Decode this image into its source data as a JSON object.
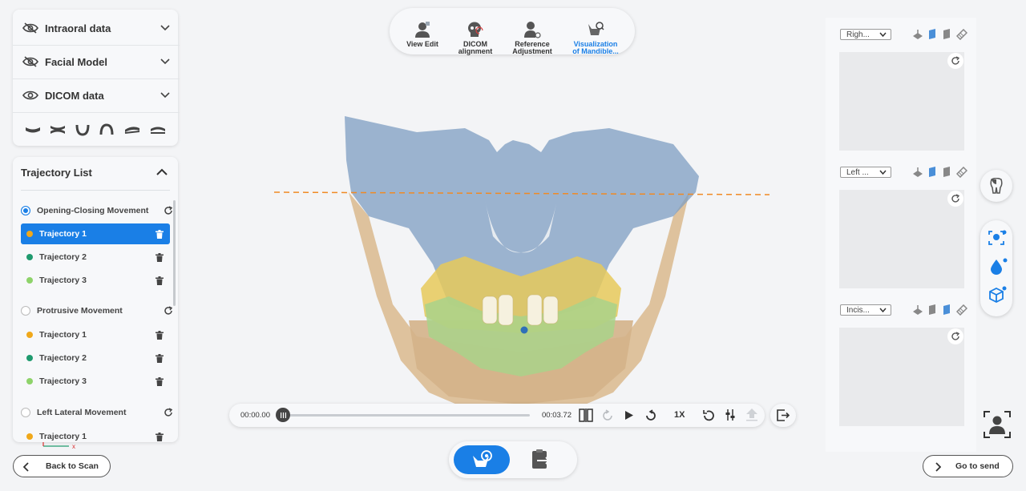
{
  "layers": [
    {
      "label": "Intraoral data",
      "visible": false
    },
    {
      "label": "Facial Model",
      "visible": false
    },
    {
      "label": "DICOM data",
      "visible": true
    }
  ],
  "view_presets": [
    "arch-lower-icon",
    "arch-both-icon",
    "arch-u-icon",
    "arch-n-icon",
    "arch-tilt-icon",
    "arch-flat-icon"
  ],
  "trajectory_list": {
    "title": "Trajectory List",
    "groups": [
      {
        "label": "Opening-Closing Movement",
        "selected": true,
        "items": [
          {
            "label": "Trajectory 1",
            "color": "#f0a81a"
          },
          {
            "label": "Trajectory 2",
            "color": "#1f9a6e"
          },
          {
            "label": "Trajectory 3",
            "color": "#8ed36a"
          }
        ]
      },
      {
        "label": "Protrusive Movement",
        "selected": false,
        "items": [
          {
            "label": "Trajectory 1",
            "color": "#f0a81a"
          },
          {
            "label": "Trajectory 2",
            "color": "#1f9a6e"
          },
          {
            "label": "Trajectory 3",
            "color": "#8ed36a"
          }
        ]
      },
      {
        "label": "Left Lateral Movement",
        "selected": false,
        "items": [
          {
            "label": "Trajectory 1",
            "color": "#f0a81a"
          }
        ]
      }
    ],
    "selected_item": "Trajectory 1"
  },
  "toolbar": {
    "tools": [
      {
        "label1": "View Edit",
        "label2": "",
        "icon": "user-edit-icon"
      },
      {
        "label1": "DICOM",
        "label2": "alignment",
        "icon": "skull-icon"
      },
      {
        "label1": "Reference",
        "label2": "Adjustment",
        "icon": "person-adjust-icon"
      },
      {
        "label1": "Visualization",
        "label2": "of Mandible...",
        "icon": "mandible-search-icon",
        "active": true
      }
    ]
  },
  "playback": {
    "current_time": "00:00.00",
    "total_time": "00:03.72",
    "speed": "1X",
    "progress": 0
  },
  "views": [
    {
      "label": "Righ..."
    },
    {
      "label": "Left ..."
    },
    {
      "label": "Incis..."
    }
  ],
  "axis": {
    "x": "x"
  },
  "nav": {
    "back_label": "Back to Scan",
    "send_label": "Go to send"
  },
  "colors": {
    "accent": "#1a7fe6",
    "guide_line": "#f08a24"
  }
}
